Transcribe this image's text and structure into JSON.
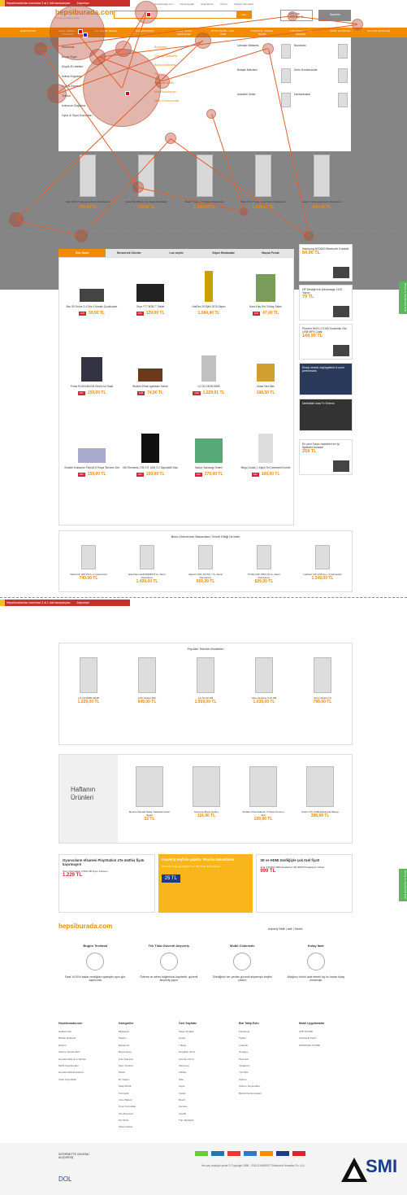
{
  "notice": {
    "text": "Hepsiburada'dan inanılmaz 3 al 1 öde kampanyası",
    "sub": "Alışverişe"
  },
  "header": {
    "logo": "hepsiburada.com",
    "tagline": "her şey aradığın yerde",
    "toplinks": [
      "Hepsiburada.com",
      "Kampanyalar",
      "Siparişlerim",
      "Yardım",
      "Müşteri Hizmetleri"
    ],
    "search_btn": "ARA",
    "login": "Giriş Yap",
    "login_sub": "veya Üye Ol",
    "cart": "Sepetim"
  },
  "nav": [
    "ELEKTRONİK",
    "ANNE, BEBEK, OYUNCAK",
    "EV, YAŞAM, BAHÇE",
    "SÜPERMARKET",
    "MODA, GİYİM, AKSESUAR",
    "KİTAP, MÜZİK, FİLM, HOBİ",
    "KOZMETİK, KİŞİSEL BAKIM",
    "OTO, BAHÇE, YAPI MARKET",
    "SPOR, OUTDOOR",
    "EN ÇOK SATANLAR"
  ],
  "megamenu": {
    "left": [
      "Elektronik",
      "Beyaz Eşya",
      "Küçük Ev Aletleri",
      "Isıtma Soğutma",
      "Foto & Kamera",
      "Telefon",
      "Isıtma ve Soğutma",
      "Oyun & Oyun Konsolları"
    ],
    "mid": [
      "Buzdolabı",
      "Çamaşır Makinesi",
      "Bulaşık Makinesi",
      "Fırın",
      "Ankastre Setler",
      "Mini Buzdolapları",
      "Derin Dondurucular"
    ],
    "grid": [
      "Çamaşır Makinesi",
      "Buzdolabı",
      "Bulaşık Makinesi",
      "Derin Dondurucular",
      "Ankastre Setler",
      "Davlumbazlar"
    ]
  },
  "deals": [
    {
      "name": "Uğur UDF 7 Çekmeceli Derin Dondurucu",
      "price": "749,00 TL",
      "old": "899,00 TL",
      "pct": "%17"
    },
    {
      "name": "Vestel NF 550 A+ Çift Kapılı Buzdolabı",
      "price": "799,00 TL",
      "old": "999,00 TL",
      "pct": "%20"
    },
    {
      "name": "Beko 7 Çekmeceli Derin Dondurucu",
      "price": "1.499,00 TL",
      "old": "1.799,00 TL",
      "pct": "%17"
    },
    {
      "name": "Beko DSF 7 Çekmeceli Derin Dondurucu",
      "price": "1.099,00 TL",
      "old": "1.299,00 TL",
      "pct": "%15"
    },
    {
      "name": "Vestel 7 Çekmeceli Derin Dondurucu",
      "price": "899,00 TL",
      "old": "1.049,00 TL",
      "pct": "%14"
    }
  ],
  "tabs": [
    "Gün Sonu",
    "Benzersiz Ürünler",
    "Lux seçim",
    "Süper Bedavalar",
    "Buçuk Fırsat"
  ],
  "grid": [
    {
      "name": "Bcu X5 Drone 2.4 Ghz 4 Kanallı Quadcopter",
      "price": "59,90 TL",
      "old": "79,90 TL",
      "pct": "%25"
    },
    {
      "name": "Onyx YT7 8GB 7\" Tablet",
      "price": "129,00 TL",
      "old": "179,00 TL",
      "pct": "%28"
    },
    {
      "name": "NatGeo 10 Eylül 2015 Sayısı",
      "price": "1.084,40 TL",
      "old": "",
      "pct": ""
    },
    {
      "name": "Kara Kutu Set 3 Kitap Takım",
      "price": "47,40 TL",
      "old": "79,00 TL",
      "pct": "%40"
    },
    {
      "name": "Puma PU103461004 Erkek Kol Saati",
      "price": "159,00 TL",
      "old": "219,00 TL",
      "pct": "%27"
    },
    {
      "name": "Wolford Erkek Ayakkabı Kahve",
      "price": "74,90 TL",
      "old": "119,90 TL",
      "pct": "%38"
    },
    {
      "name": "LG G3 16GB D855",
      "price": "1.229,01 TL",
      "old": "1.499,00 TL",
      "pct": "%18"
    },
    {
      "name": "Ziraat Tam Altın",
      "price": "188,50 TL",
      "old": "",
      "pct": ""
    },
    {
      "name": "Schafer Multicolor Pürüzlü 8 Parça Tencere Seti",
      "price": "159,90 TL",
      "old": "229,90 TL",
      "pct": "%30"
    },
    {
      "name": "WD Elements 1TB 2.5\" USB 3.0 Taşınabilir Disk",
      "price": "169,99 TL",
      "old": "219,99 TL",
      "pct": "%23"
    },
    {
      "name": "Bahçe Salıncağı Tenteli",
      "price": "379,90 TL",
      "old": "499,90 TL",
      "pct": "%24"
    },
    {
      "name": "Bingo Dondu 1 Kapılı Tel Çekmeceli Kombi",
      "price": "169,90 TL",
      "old": "229,90 TL",
      "pct": "%26"
    }
  ],
  "side": [
    {
      "title": "Samsung HS3000 Bluetooth Kulaklık",
      "price": "84,90 TL"
    },
    {
      "title": "HP Deskjet Ink Advantage 1115 Yazıcı",
      "price": "79 TL"
    },
    {
      "title": "Pioneer MVH-171UB Kuranlıklı Oto USB MP3 Çalar",
      "price": "149,90 TL"
    },
    {
      "title": "Enerji verimli süpürgelerle A sınıfı performans",
      "price": ""
    },
    {
      "title": "Derinlikte Usta Tv Önlemi",
      "price": ""
    },
    {
      "title": "En yeni Casio modelleri en iyi fiyatlarla burada!",
      "price": "259 TL"
    }
  ],
  "beko": {
    "title": "Beko Ürünlerine Bakanların Tercih Ettiği Ürünler",
    "items": [
      {
        "name": "Daha DF 195 V/3 A+ 1 Çekmeceli",
        "price": "749,00 TL"
      },
      {
        "name": "Electrolux EUF2330DOX A+ Derin Dondurucu",
        "price": "1.499,00 TL"
      },
      {
        "name": "Indesit UIAA 10 (TK) 7 A+ Derin Dondurucu",
        "price": "569,99 TL"
      },
      {
        "name": "Profilo FZF 2353 QF A+ Derin Dondurucu",
        "price": "829,00 TL"
      },
      {
        "name": "Liebherr GP 1476 A++ 4 Çekmeceli",
        "price": "1.349,00 TL"
      }
    ]
  },
  "phones": {
    "title": "Popüler Telefon Modelleri",
    "items": [
      {
        "name": "LG G3 D855 32GB",
        "price": "1.229,00 TL"
      },
      {
        "name": "HTC Desire 816",
        "price": "649,00 TL"
      },
      {
        "name": "LG G4 32 GB",
        "price": "1.959,00 TL"
      },
      {
        "name": "Asus Zenfone 5 16 GB",
        "price": "1.039,00 TL"
      },
      {
        "name": "Sony Xperia C3",
        "price": "799,00 TL"
      }
    ]
  },
  "weekly": {
    "label1": "Haftanın",
    "label2": "Ürünleri",
    "items": [
      {
        "name": "Moonie Dantelli Saten Sabahlık Kadın Siyah",
        "price": "22 TL"
      },
      {
        "name": "Decomix Bovel Sehpa",
        "price": "116,90 TL"
      },
      {
        "name": "Schafer Diva Valentin 7 Parça Tencere Seti",
        "price": "199,90 TL"
      },
      {
        "name": "Casio CTK-2400 Elektronik Klavye",
        "price": "398,99 TL"
      }
    ]
  },
  "banners": [
    {
      "t": "Oyuncuların efsanesi PlayStation 4'te müthiş fiyatı kaçırmayın!",
      "s": "Sony Playstation 4 500 GB Oyun Konsolu",
      "p": "1.229 TL"
    },
    {
      "t": "Alışveriş keyfi ile yapılın, Visa ile tamamlanın.",
      "s": "Visa kartınızla yapacağınız her 150 TL'lik alışverişinize",
      "p": "25 TL"
    },
    {
      "t": "3D ve HDMI özelliğiyle çok özel fiyat!",
      "s": "Acer X113PH 2000 Ansilümen 3D HDMI Projeksiyon Cihazı",
      "p": "999 TL"
    }
  ],
  "footer": {
    "logo": "hepsiburada.com",
    "links": "Alışveriş Takibi | İade | Yardım",
    "features": [
      {
        "title": "Bugün Teslimat",
        "desc": "Saat 14:00'e kadar verdiğiniz siparişler aynı gün kapınızda"
      },
      {
        "title": "Tek Tıkla Güvenli Alışveriş",
        "desc": "Ödeme ve adres bilgilerinizi kaydedin, güvenli alışveriş yapın"
      },
      {
        "title": "Mobil Cebinizde",
        "desc": "Dilediğiniz her yerden güvenli alışverişin keyfini çıkarın"
      },
      {
        "title": "Kolay İade",
        "desc": "Aldığınız ürünü iade etmek hiç bu kadar kolay olmamıştı"
      }
    ],
    "cols": [
      {
        "h": "Hepsiburada.com",
        "items": [
          "Hakkımızda",
          "Bizden Haberler",
          "İletişim",
          "Ödeme Seçenekleri",
          "Hepsiburada.com Tarihçe",
          "Mobil Uygulamalar",
          "Hepsiburada'da Kariyer",
          "İnsan Kaynakları"
        ]
      },
      {
        "h": "Kategoriler",
        "items": [
          "Bilgisayar",
          "Telefon",
          "Elektronik",
          "Beyaz Eşya",
          "Foto Kamera",
          "Spor Outdoor",
          "Moda",
          "Ev Yaşam",
          "Kitap Müzik",
          "Kozmetik",
          "Anne Bebek",
          "Oyun Konsolları",
          "Oto Aksesuar",
          "Pet Shop",
          "Süpermarket"
        ]
      },
      {
        "h": "Özel Sayfalar",
        "items": [
          "Süper Fiyatlar",
          "Outlet",
          "Yılbaşı",
          "Sevgililer Günü",
          "Anneler Günü",
          "Samsung",
          "Adidas",
          "Nike",
          "Apple",
          "Vestel",
          "Bosch",
          "Lacoste",
          "Arçelik",
          "Tüm Markalar"
        ]
      },
      {
        "h": "Bizi Takip Edin",
        "items": [
          "Facebook",
          "Twitter",
          "Linkedin",
          "Google+",
          "Pinterest",
          "Instagram",
          "YouTube",
          "Ödeme",
          "Ödeme Seçenekleri",
          "Banka Kampanyaları"
        ]
      },
      {
        "h": "Mobil Uygulamalar",
        "items": [
          "APP STORE",
          "GOOGLE PLAY",
          "WINDOWS STORE"
        ]
      }
    ],
    "bottom": "Her şey aradığın yerde © Copyright 1998 - 2015 D-MARKET Elektronik Hizmetler Tic. A.Ş.",
    "secure": "İNTERNETTE GÜVENLİ ALIŞVERİŞ",
    "dol": "DOL",
    "watermark": "SMI"
  },
  "green_tab": "Görüş ve önerilerinizi iletin",
  "colors": {
    "brand": "#f28b00",
    "heat": "#b43c28",
    "badge": "#d9232d"
  }
}
